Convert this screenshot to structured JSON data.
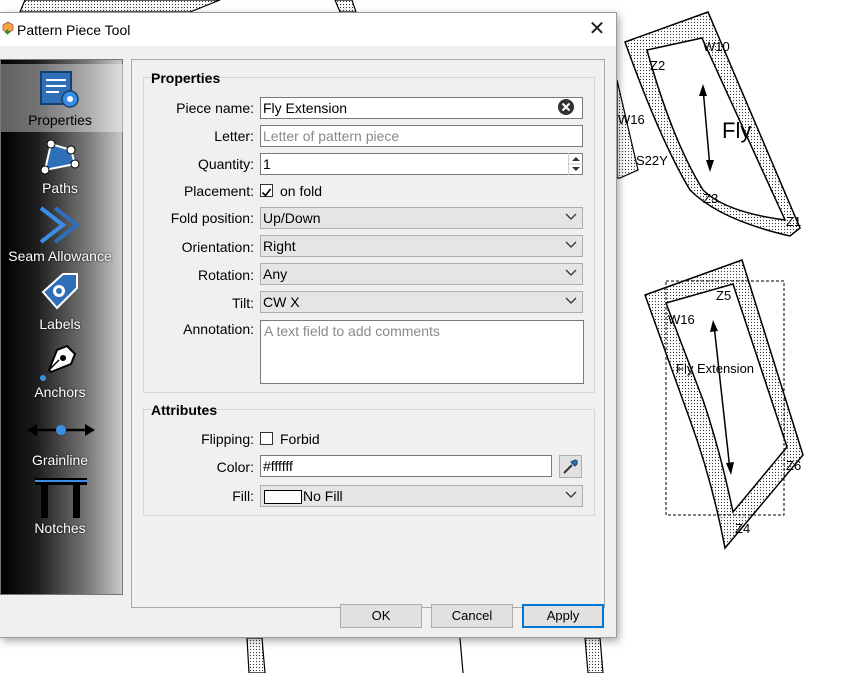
{
  "window": {
    "title": "Pattern Piece Tool",
    "close_glyph": "✕"
  },
  "sidebar": {
    "items": [
      {
        "label": "Properties",
        "icon": "properties-icon",
        "active": true
      },
      {
        "label": "Paths",
        "icon": "paths-icon",
        "active": false
      },
      {
        "label": "Seam Allowance",
        "icon": "seam-allowance-icon",
        "active": false
      },
      {
        "label": "Labels",
        "icon": "labels-icon",
        "active": false
      },
      {
        "label": "Anchors",
        "icon": "anchors-icon",
        "active": false
      },
      {
        "label": "Grainline",
        "icon": "grainline-icon",
        "active": false
      },
      {
        "label": "Notches",
        "icon": "notches-icon",
        "active": false
      }
    ]
  },
  "properties": {
    "title": "Properties",
    "piece_name": {
      "label": "Piece name:",
      "value": "Fly Extension"
    },
    "letter": {
      "label": "Letter:",
      "placeholder": "Letter of pattern piece"
    },
    "quantity": {
      "label": "Quantity:",
      "value": "1"
    },
    "placement": {
      "label": "Placement:",
      "checkbox_label": "on fold",
      "checked": true
    },
    "fold_position": {
      "label": "Fold position:",
      "value": "Up/Down"
    },
    "orientation": {
      "label": "Orientation:",
      "value": "Right"
    },
    "rotation": {
      "label": "Rotation:",
      "value": "Any"
    },
    "tilt": {
      "label": "Tilt:",
      "value": "CW X"
    },
    "annotation": {
      "label": "Annotation:",
      "placeholder": "A text field to add comments"
    }
  },
  "attributes": {
    "title": "Attributes",
    "flipping": {
      "label": "Flipping:",
      "checkbox_label": "Forbid",
      "checked": false
    },
    "color": {
      "label": "Color:",
      "value": "#ffffff"
    },
    "fill": {
      "label": "Fill:",
      "value": "No Fill"
    }
  },
  "buttons": {
    "ok": "OK",
    "cancel": "Cancel",
    "apply": "Apply"
  },
  "canvas": {
    "labels": [
      "W10",
      "Z2",
      "Fly",
      "Z3",
      "Z1",
      "W16",
      "S22Y",
      "Z5",
      "W16",
      "Fly Extension",
      "Z6",
      "Z4"
    ]
  },
  "colors": {
    "accent": "#0078d7",
    "sidebar_dark": "#000000",
    "panel": "#f0f0f0"
  }
}
